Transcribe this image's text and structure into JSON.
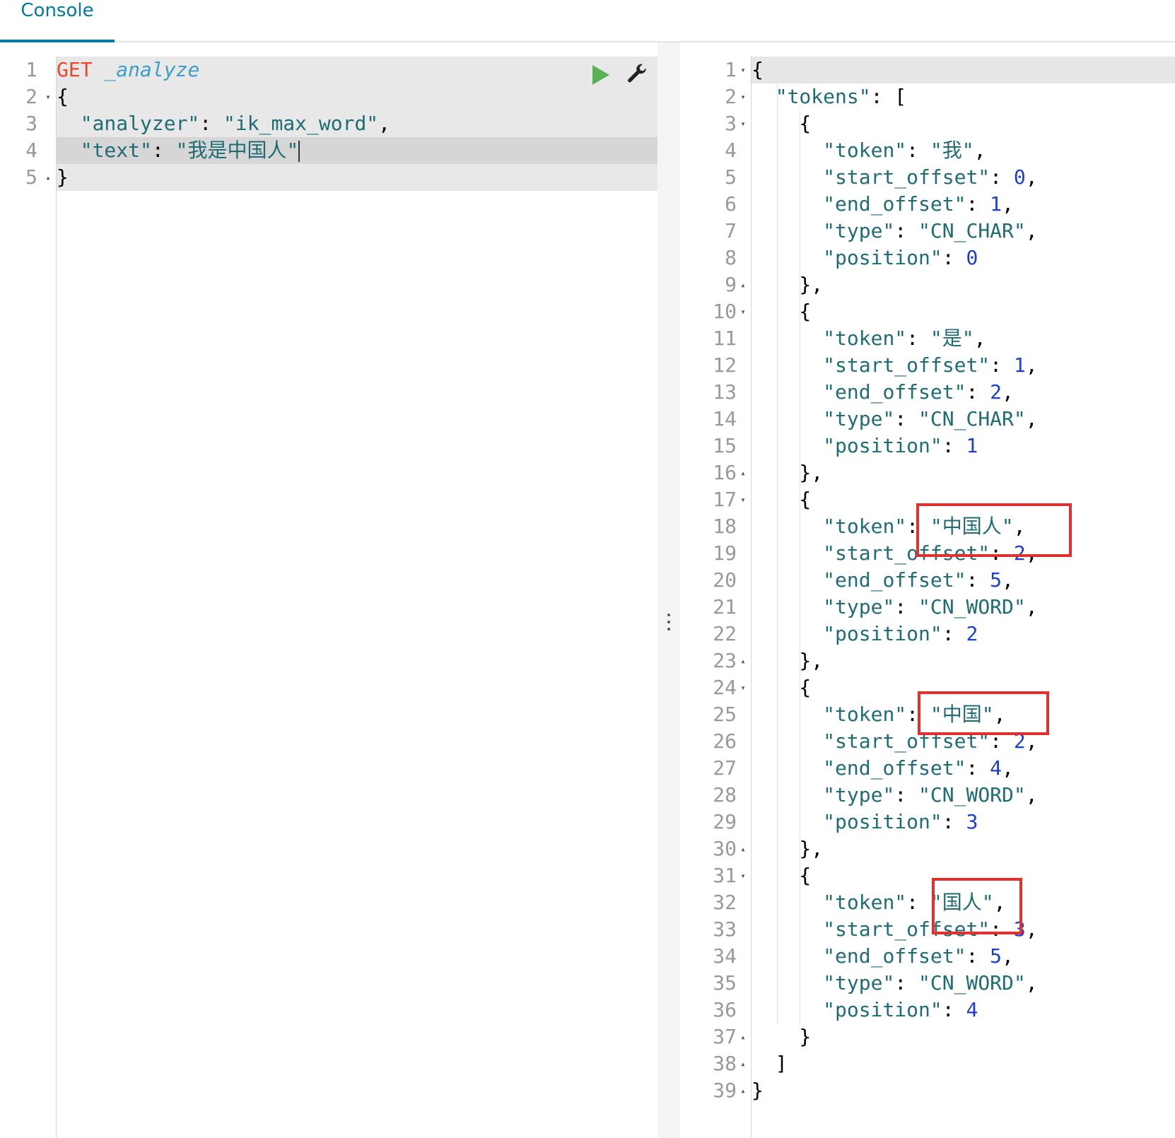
{
  "tab": {
    "label": "Console"
  },
  "request": {
    "method": "GET",
    "path": "_analyze",
    "line_numbers": [
      "1",
      "2",
      "3",
      "4",
      "5"
    ],
    "open_brace": "{",
    "close_brace": "}",
    "analyzer_key": "\"analyzer\"",
    "analyzer_value": "\"ik_max_word\"",
    "text_key": "\"text\"",
    "text_value": "\"我是中国人\""
  },
  "actions": {
    "send_icon": "play-icon",
    "settings_icon": "wrench-icon"
  },
  "response": {
    "line_numbers": [
      "1",
      "2",
      "3",
      "4",
      "5",
      "6",
      "7",
      "8",
      "9",
      "10",
      "11",
      "12",
      "13",
      "14",
      "15",
      "16",
      "17",
      "18",
      "19",
      "20",
      "21",
      "22",
      "23",
      "24",
      "25",
      "26",
      "27",
      "28",
      "29",
      "30",
      "31",
      "32",
      "33",
      "34",
      "35",
      "36",
      "37",
      "38",
      "39"
    ],
    "open_brace": "{",
    "close_brace": "}",
    "tokens_key": "\"tokens\"",
    "open_bracket": "[",
    "close_bracket": "]",
    "tokens": [
      {
        "token": "\"我\"",
        "start_offset": "0",
        "end_offset": "1",
        "type": "\"CN_CHAR\"",
        "position": "0"
      },
      {
        "token": "\"是\"",
        "start_offset": "1",
        "end_offset": "2",
        "type": "\"CN_CHAR\"",
        "position": "1"
      },
      {
        "token": "\"中国人\"",
        "start_offset": "2",
        "end_offset": "5",
        "type": "\"CN_WORD\"",
        "position": "2"
      },
      {
        "token": "\"中国\"",
        "start_offset": "2",
        "end_offset": "4",
        "type": "\"CN_WORD\"",
        "position": "3"
      },
      {
        "token": "\"国人\"",
        "start_offset": "3",
        "end_offset": "5",
        "type": "\"CN_WORD\"",
        "position": "4"
      }
    ],
    "keys": {
      "token": "\"token\"",
      "start_offset": "\"start_offset\"",
      "end_offset": "\"end_offset\"",
      "type": "\"type\"",
      "position": "\"position\""
    }
  },
  "colors": {
    "accent": "#0079a5",
    "method": "#e8482d",
    "string": "#1f6d74",
    "number": "#1a3fd1",
    "highlight": "#e03131",
    "play": "#58b153"
  }
}
